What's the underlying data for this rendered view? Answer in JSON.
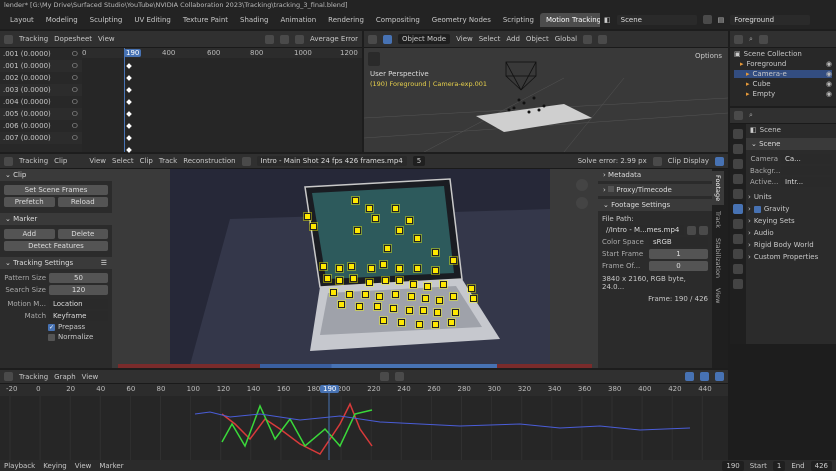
{
  "titlebar": {
    "text": "lender* [G:\\My Drive\\Surfaced Studio\\YouTube\\NVIDIA Collaboration 2023\\Tracking\\tracking_3_final.blend]"
  },
  "workspace_tabs": [
    "Layout",
    "Modeling",
    "Sculpting",
    "UV Editing",
    "Texture Paint",
    "Shading",
    "Animation",
    "Rendering",
    "Compositing",
    "Geometry Nodes",
    "Scripting",
    "Motion Tracking"
  ],
  "active_tab": "Motion Tracking",
  "scene": {
    "label": "Scene",
    "view_layer": "Foreground"
  },
  "dopesheet": {
    "mode": "Tracking",
    "editor": "Dopesheet",
    "view": "View",
    "sort": "Average Error",
    "ticks": [
      "0",
      "190",
      "400",
      "600",
      "800",
      "1000",
      "1200"
    ],
    "rows": [
      ".001 (0.0000)",
      ".001 (0.0000)",
      ".002 (0.0000)",
      ".003 (0.0000)",
      ".004 (0.0000)",
      ".005 (0.0000)",
      ".006 (0.0000)",
      ".007 (0.0000)"
    ]
  },
  "viewport3d": {
    "mode": "Object Mode",
    "menus": [
      "View",
      "Select",
      "Add",
      "Object"
    ],
    "orientation": "Global",
    "options": "Options",
    "title": "User Perspective",
    "subtitle": "(190) Foreground | Camera-exp.001"
  },
  "outliner": {
    "header": "Scene Collection",
    "items": [
      {
        "label": "Foreground",
        "indent": 1
      },
      {
        "label": "Camera-e",
        "indent": 2,
        "selected": true
      },
      {
        "label": "Cube",
        "indent": 2
      },
      {
        "label": "Empty",
        "indent": 2
      }
    ]
  },
  "properties": {
    "context": "Scene",
    "section": "Scene",
    "camera_label": "Camera",
    "camera_value": "Ca...",
    "background_label": "Backgr...",
    "active_label": "Active...",
    "active_value": "Intr...",
    "subsections": [
      "Units",
      "Gravity",
      "Keying Sets",
      "Audio",
      "Rigid Body World",
      "Custom Properties"
    ]
  },
  "clip_editor": {
    "mode": "Tracking",
    "editor": "Clip",
    "menus": [
      "View",
      "Select",
      "Clip",
      "Track",
      "Reconstruction"
    ],
    "clip_name": "Intro - Main Shot 24 fps 426 frames.mp4",
    "clip_users": "5",
    "solve_error": "Solve error: 2.99 px",
    "display": "Clip Display"
  },
  "tools_panel": {
    "clip": {
      "title": "Clip",
      "set_scene_frames": "Set Scene Frames",
      "prefetch": "Prefetch",
      "reload": "Reload"
    },
    "marker": {
      "title": "Marker",
      "add": "Add",
      "delete": "Delete",
      "detect": "Detect Features"
    },
    "tracking_settings": {
      "title": "Tracking Settings",
      "pattern_size_label": "Pattern Size",
      "pattern_size": "50",
      "search_size_label": "Search Size",
      "search_size": "120",
      "motion_label": "Motion M...",
      "motion_value": "Location",
      "match_label": "Match",
      "match_value": "Keyframe",
      "prepass": "Prepass",
      "normalize": "Normalize"
    }
  },
  "footage_panel": {
    "metadata": "Metadata",
    "proxy": "Proxy/Timecode",
    "footage_settings": "Footage Settings",
    "file_path_label": "File Path:",
    "file_path": "//Intro - M...mes.mp4",
    "color_space_label": "Color Space",
    "color_space": "sRGB",
    "start_frame_label": "Start Frame",
    "start_frame": "1",
    "frame_offset_label": "Frame Of...",
    "frame_offset": "0",
    "info": "3840 x 2160, RGB byte, 24.0...",
    "frame": "Frame: 190 / 426",
    "side_tabs": [
      "Footage",
      "Track",
      "Stabilization",
      "View"
    ]
  },
  "graph_editor": {
    "mode": "Tracking",
    "editor": "Graph",
    "view": "View",
    "ticks": [
      "-20",
      "0",
      "20",
      "40",
      "60",
      "80",
      "100",
      "120",
      "140",
      "160",
      "180",
      "190",
      "200",
      "220",
      "240",
      "260",
      "280",
      "300",
      "320",
      "340",
      "360",
      "380",
      "400",
      "420",
      "440"
    ],
    "current_frame": "190"
  },
  "bottom_bar": {
    "items": [
      "Playback",
      "Keying",
      "View",
      "Marker"
    ],
    "frame": "190",
    "start_label": "Start",
    "start": "1",
    "end_label": "End",
    "end": "426"
  },
  "colors": {
    "accent": "#4772b3",
    "track": "#ffe800",
    "active_tab_bg": "#4c4c4c"
  }
}
